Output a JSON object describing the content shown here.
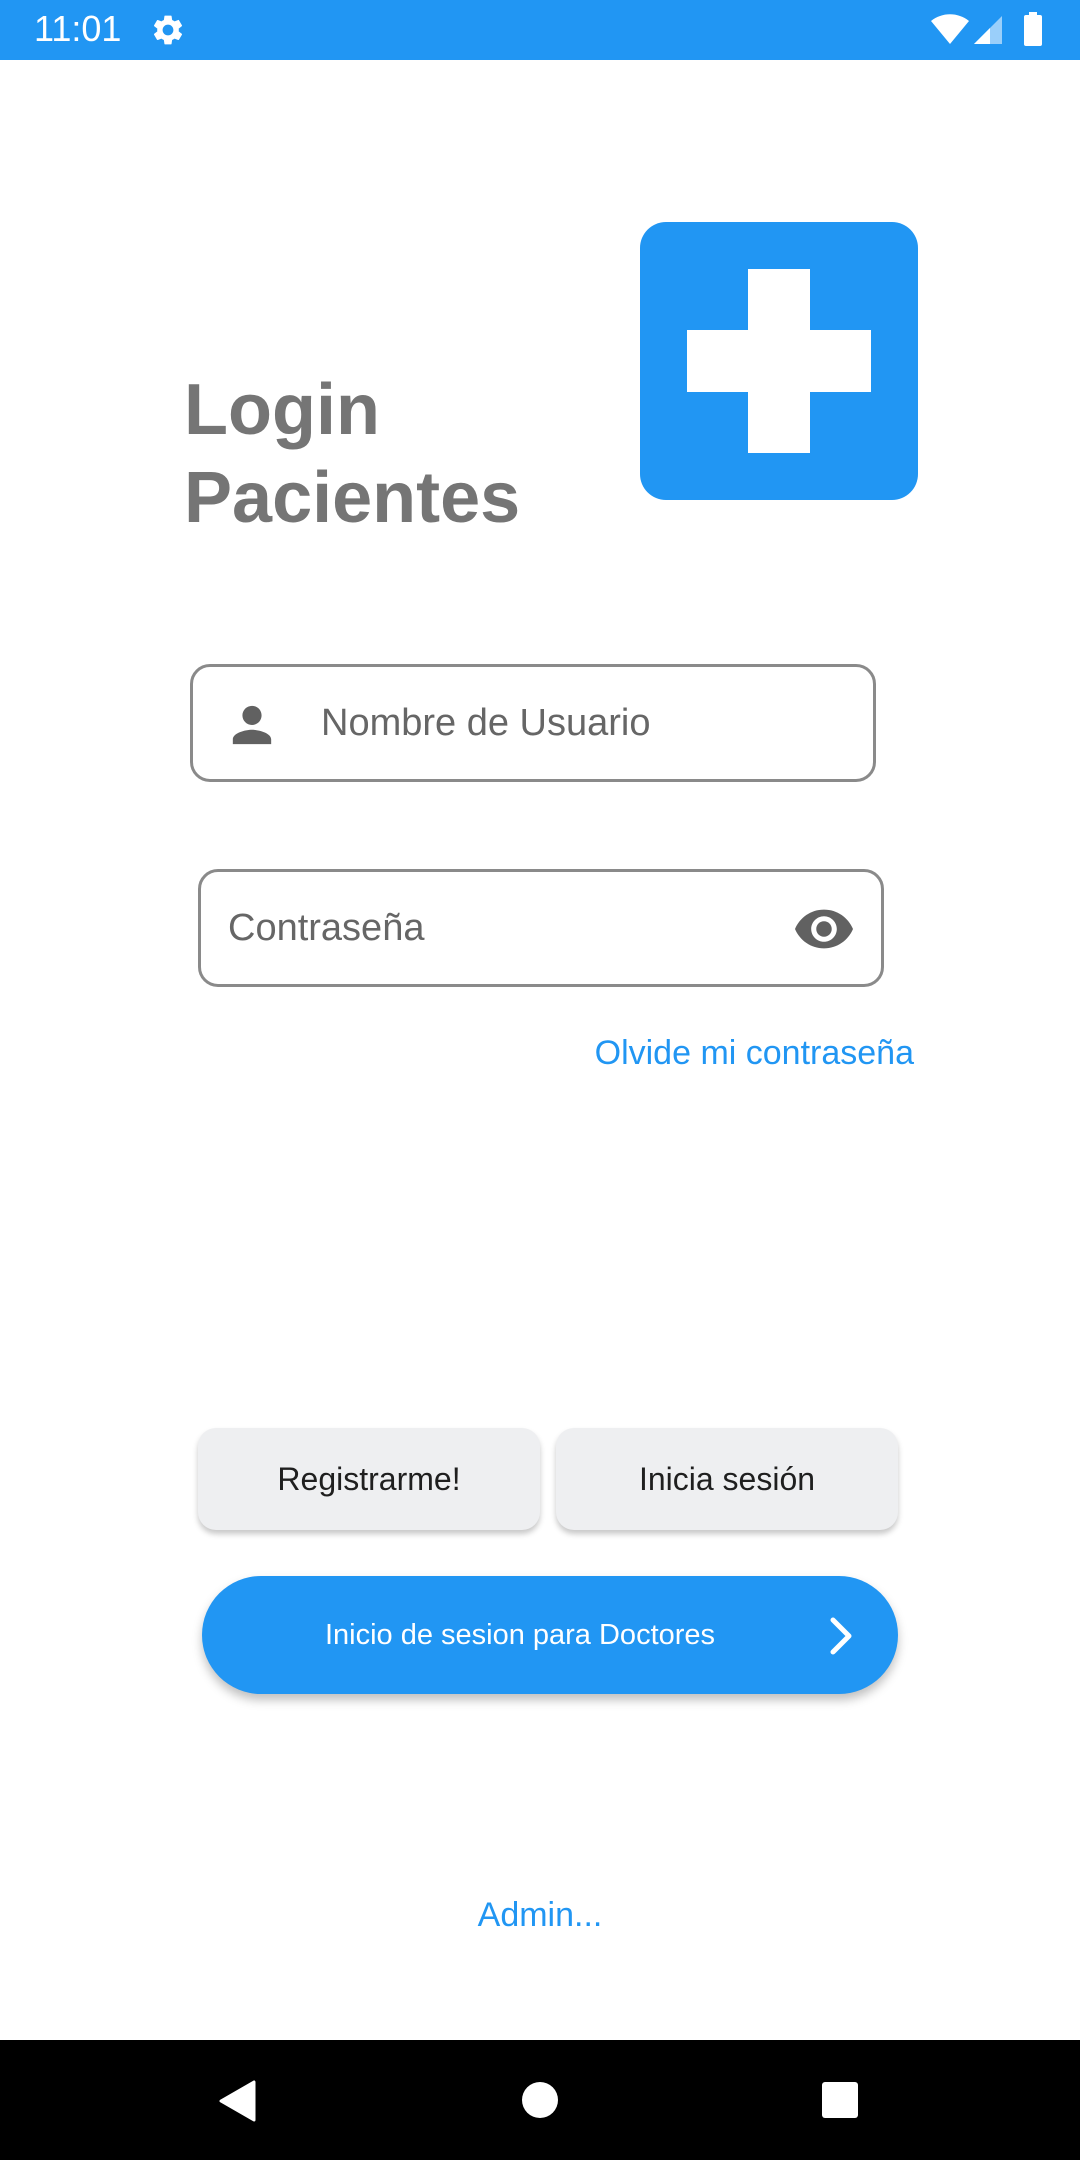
{
  "status_bar": {
    "time": "11:01",
    "background_color": "#2196f3",
    "icons": [
      "gear-icon",
      "wifi-icon",
      "signal-icon",
      "battery-icon"
    ]
  },
  "header": {
    "title_line1": "Login",
    "title_line2": "Pacientes",
    "logo_icon": "medical-cross-icon",
    "accent_color": "#2196f3"
  },
  "form": {
    "username": {
      "placeholder": "Nombre de Usuario",
      "value": "",
      "icon": "person-icon"
    },
    "password": {
      "placeholder": "Contraseña",
      "value": "",
      "icon": "eye-icon"
    },
    "forgot_label": "Olvide mi contraseña"
  },
  "actions": {
    "register_label": "Registrarme!",
    "login_label": "Inicia sesión",
    "doctor_login_label": "Inicio de sesion para Doctores",
    "doctor_icon": "chevron-right-icon"
  },
  "footer": {
    "admin_label": "Admin..."
  },
  "nav_bar": {
    "icons": [
      "back-icon",
      "home-icon",
      "recents-icon"
    ]
  }
}
